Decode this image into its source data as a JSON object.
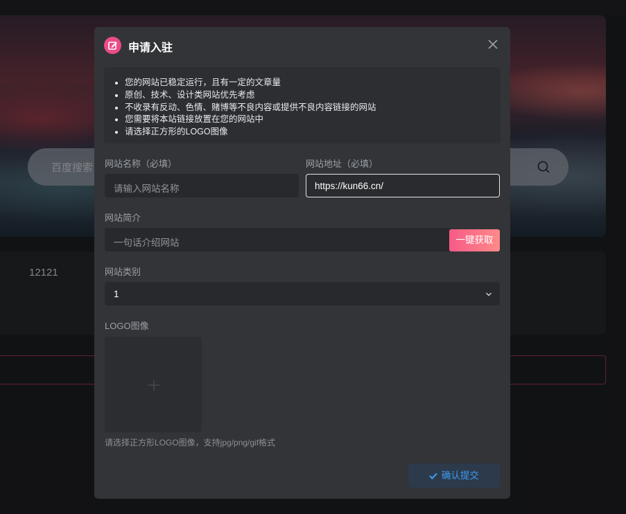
{
  "background": {
    "search_placeholder": "百度搜索",
    "card_text": "12121"
  },
  "modal": {
    "title": "申请入驻",
    "notice_items": [
      "您的网站已稳定运行，且有一定的文章量",
      "原创、技术、设计类网站优先考虑",
      "不收录有反动、色情、赌博等不良内容或提供不良内容链接的网站",
      "您需要将本站链接放置在您的网站中",
      "请选择正方形的LOGO图像"
    ],
    "site_name": {
      "label": "网站名称（必填）",
      "placeholder": "请输入网站名称",
      "value": ""
    },
    "site_url": {
      "label": "网站地址（必填）",
      "value": "https://kun66.cn/"
    },
    "site_desc": {
      "label": "网站简介",
      "placeholder": "一句话介绍网站",
      "fetch_label": "一键获取"
    },
    "site_category": {
      "label": "网站类别",
      "selected": "1"
    },
    "logo": {
      "label": "LOGO图像",
      "hint": "请选择正方形LOGO图像，支持jpg/png/gif格式"
    },
    "submit_label": "确认提交"
  },
  "colors": {
    "accent_pink": "#ea4c89",
    "submit_blue": "#3d9bf0",
    "modal_bg": "#333437"
  }
}
